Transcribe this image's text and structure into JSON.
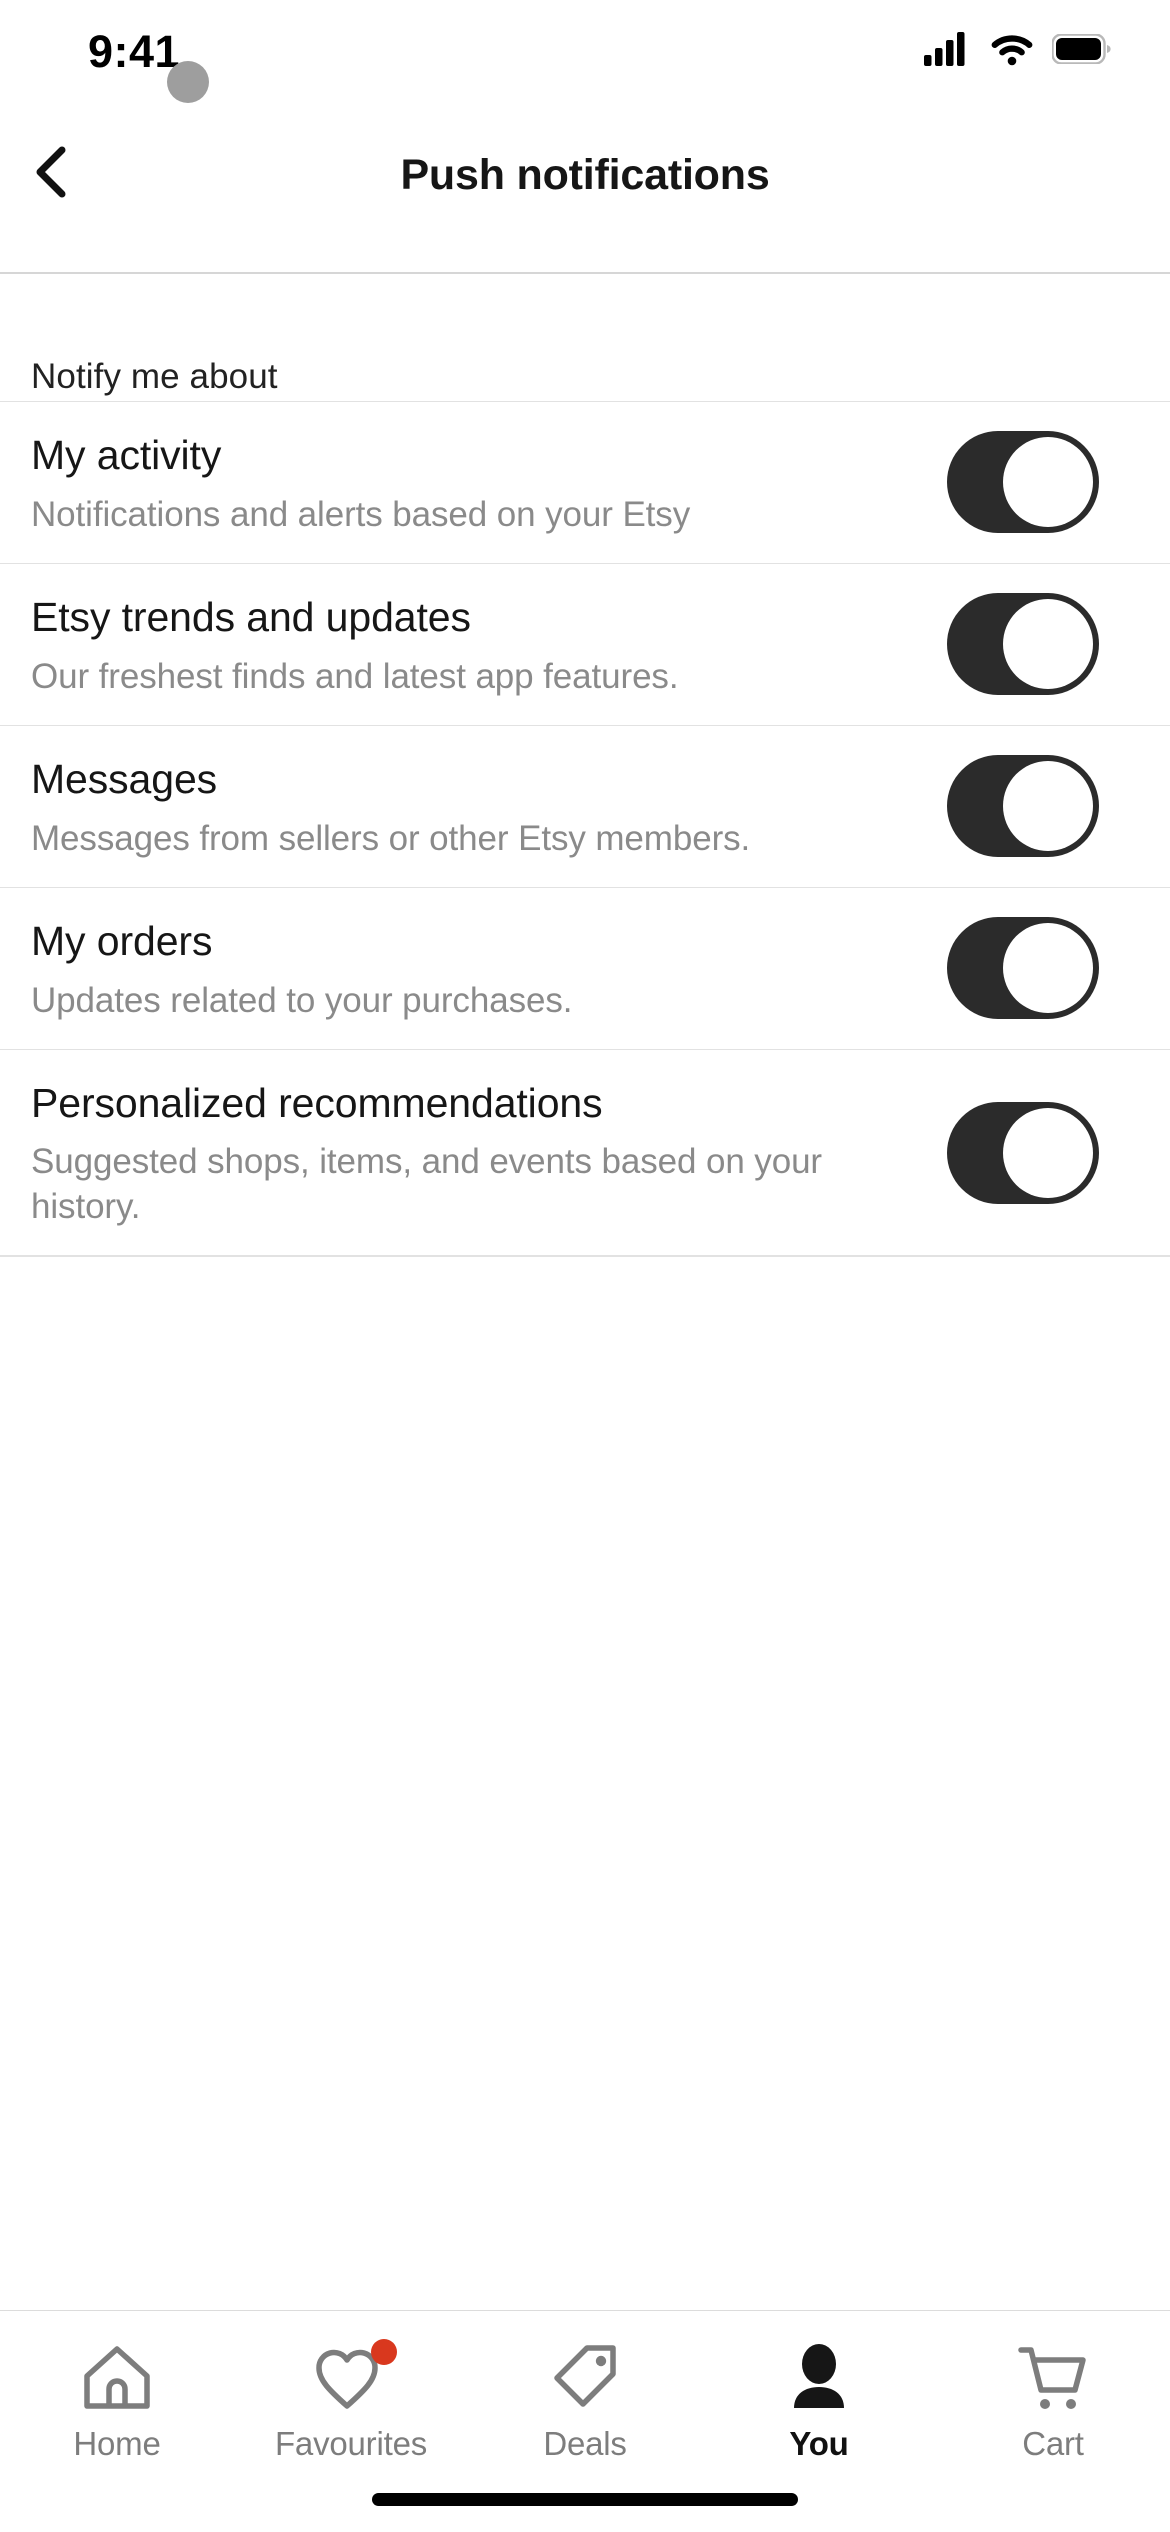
{
  "status_bar": {
    "time": "9:41",
    "icons": [
      "cellular-signal-icon",
      "wifi-icon",
      "battery-icon"
    ]
  },
  "header": {
    "back_icon": "chevron-left-icon",
    "title": "Push notifications"
  },
  "main": {
    "section_label": "Notify me about",
    "rows": [
      {
        "title": "My activity",
        "subtitle": "Notifications and alerts based on your Etsy",
        "toggle_state": "on"
      },
      {
        "title": "Etsy trends and updates",
        "subtitle": "Our freshest finds and latest app features.",
        "toggle_state": "on"
      },
      {
        "title": "Messages",
        "subtitle": "Messages from sellers or other Etsy members.",
        "toggle_state": "on"
      },
      {
        "title": "My orders",
        "subtitle": "Updates related to your purchases.",
        "toggle_state": "on"
      },
      {
        "title": "Personalized recommendations",
        "subtitle": "Suggested shops, items, and events based on your history.",
        "toggle_state": "on"
      }
    ]
  },
  "tabbar": {
    "tabs": [
      {
        "label": "Home",
        "icon": "home-icon",
        "active": false,
        "badge": false
      },
      {
        "label": "Favourites",
        "icon": "heart-icon",
        "active": false,
        "badge": true
      },
      {
        "label": "Deals",
        "icon": "tag-icon",
        "active": false,
        "badge": false
      },
      {
        "label": "You",
        "icon": "person-icon",
        "active": true,
        "badge": false
      },
      {
        "label": "Cart",
        "icon": "shopping-cart-icon",
        "active": false,
        "badge": false
      }
    ]
  },
  "colors": {
    "toggle_on_track": "#2b2b2b",
    "toggle_knob": "#ffffff",
    "badge_red": "#d9381e",
    "text_primary": "#161616",
    "text_secondary": "#8a8a8a",
    "divider": "#e2e2e2",
    "tab_inactive": "#7d7d7d",
    "tab_active": "#111111"
  }
}
